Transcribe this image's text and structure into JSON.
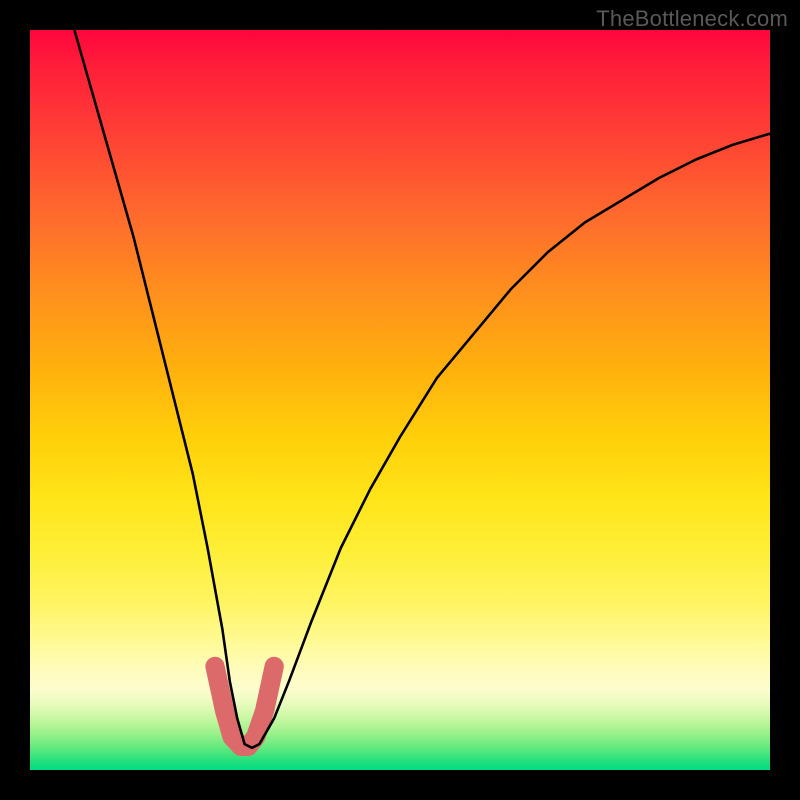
{
  "watermark": "TheBottleneck.com",
  "chart_data": {
    "type": "line",
    "title": "",
    "xlabel": "",
    "ylabel": "",
    "xlim": [
      0,
      100
    ],
    "ylim": [
      0,
      100
    ],
    "grid": false,
    "curve": {
      "description": "V-shaped curve, steep descent then rising concave arc",
      "x": [
        6,
        8,
        10,
        12,
        14,
        16,
        18,
        20,
        22,
        24,
        26,
        27,
        28,
        29,
        30,
        31,
        33,
        35,
        38,
        42,
        46,
        50,
        55,
        60,
        65,
        70,
        75,
        80,
        85,
        90,
        95,
        100
      ],
      "y": [
        100,
        93,
        86,
        79,
        72,
        64,
        56,
        48,
        40,
        30,
        19,
        12,
        7,
        3.5,
        3,
        3.5,
        7,
        12,
        20,
        30,
        38,
        45,
        53,
        59,
        65,
        70,
        74,
        77,
        80,
        82.5,
        84.5,
        86
      ]
    },
    "highlight": {
      "description": "thick salmon U-stroke at trough",
      "x": [
        25,
        26.3,
        27.3,
        28.5,
        29.5,
        30.5,
        31.7,
        33
      ],
      "y": [
        14,
        8,
        4.5,
        3.2,
        3.2,
        4.5,
        8,
        14
      ],
      "color": "#dd6a6a"
    },
    "gradient_stops": [
      {
        "pos": 0,
        "color": "#ff053c"
      },
      {
        "pos": 50,
        "color": "#ffcf0a"
      },
      {
        "pos": 88,
        "color": "#fdfdce"
      },
      {
        "pos": 100,
        "color": "#00de84"
      }
    ]
  }
}
